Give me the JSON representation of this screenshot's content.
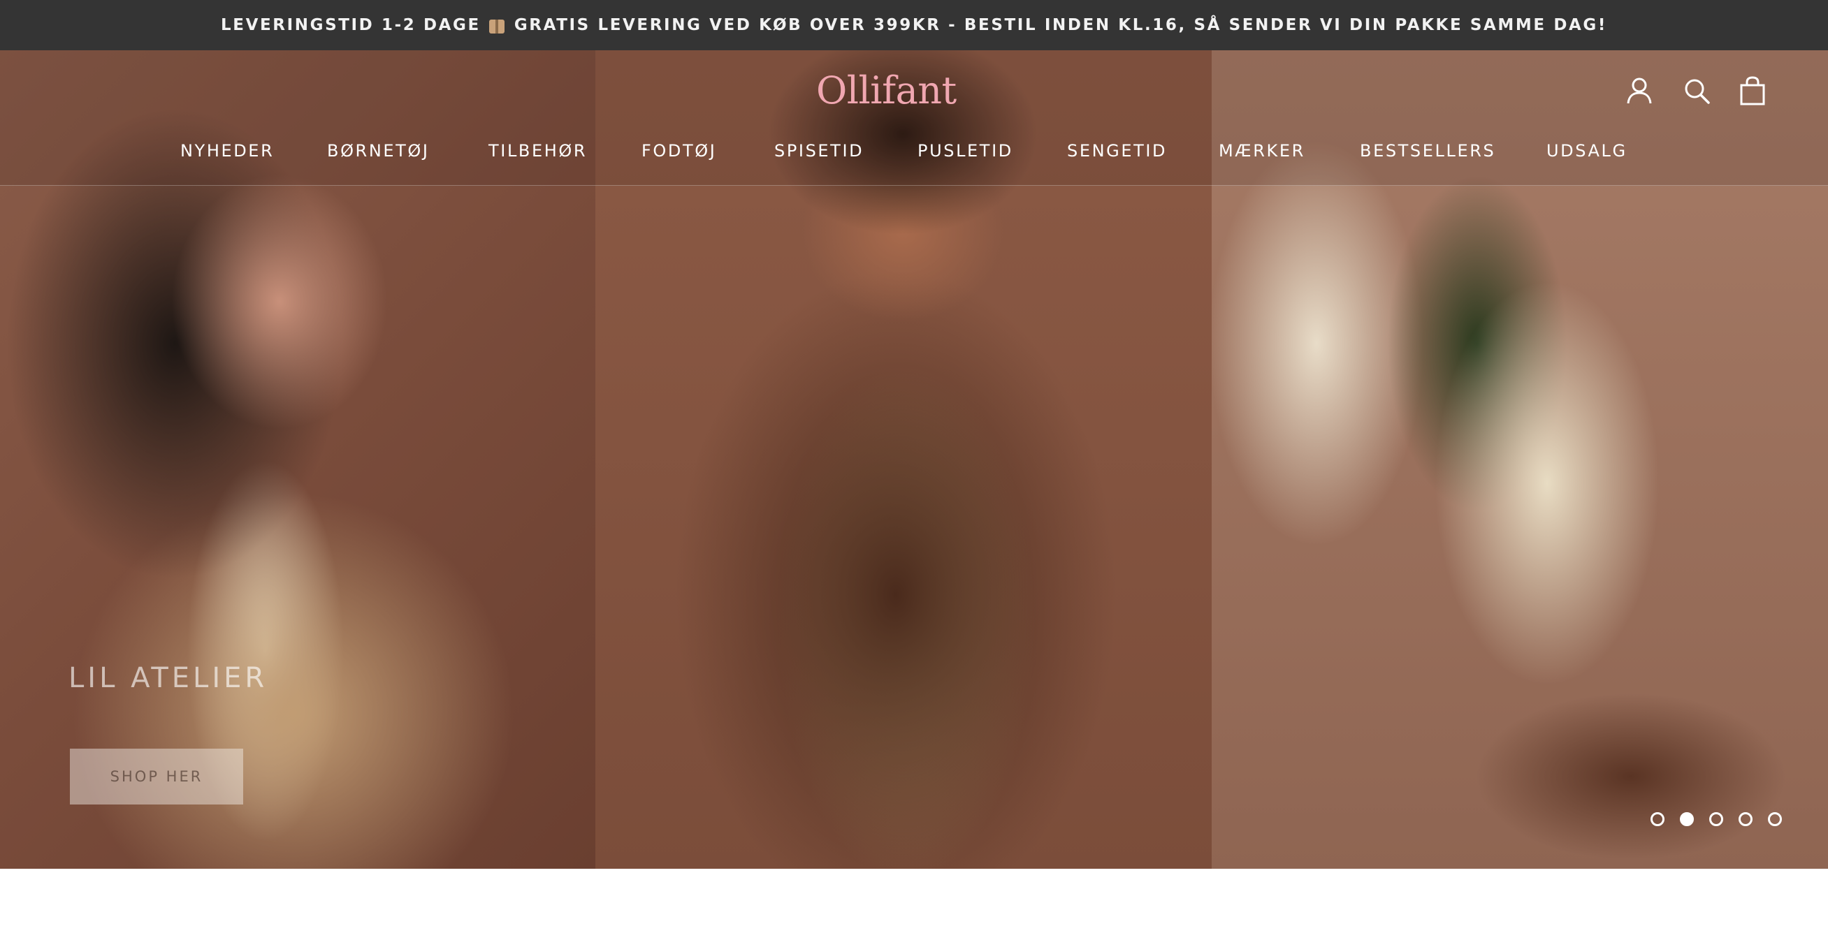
{
  "announcement": {
    "text_before": "LEVERINGSTID 1-2 DAGE",
    "icon": "package-emoji",
    "text_after": "GRATIS LEVERING VED KØB OVER 399KR - BESTIL INDEN KL.16, SÅ SENDER VI DIN PAKKE SAMME DAG!"
  },
  "header": {
    "logo": "Ollifant",
    "icons": [
      "account-icon",
      "search-icon",
      "cart-icon"
    ]
  },
  "nav": {
    "items": [
      "NYHEDER",
      "BØRNETØJ",
      "TILBEHØR",
      "FODTØJ",
      "SPISETID",
      "PUSLETID",
      "SENGETID",
      "MÆRKER",
      "BESTSELLERS",
      "UDSALG"
    ]
  },
  "hero": {
    "title": "LIL ATELIER",
    "button": "SHOP HER",
    "slides_total": 5,
    "active_slide": 2
  },
  "colors": {
    "announcement_bg": "#343434",
    "logo": "#f0a7b1"
  }
}
